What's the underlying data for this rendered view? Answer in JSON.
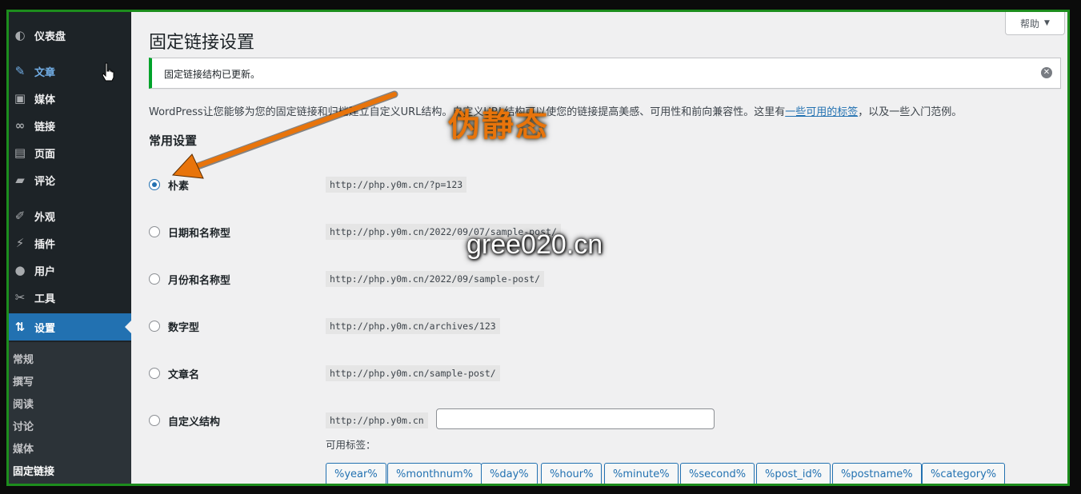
{
  "sidebar": {
    "items": [
      {
        "id": "dashboard",
        "label": "仪表盘",
        "icon": "dashboard-icon",
        "glyph": "◐"
      },
      {
        "id": "posts",
        "label": "文章",
        "icon": "pin-icon",
        "glyph": "✎"
      },
      {
        "id": "media",
        "label": "媒体",
        "icon": "media-icon",
        "glyph": "▣"
      },
      {
        "id": "links",
        "label": "链接",
        "icon": "link-icon",
        "glyph": "∞"
      },
      {
        "id": "pages",
        "label": "页面",
        "icon": "page-icon",
        "glyph": "▤"
      },
      {
        "id": "comments",
        "label": "评论",
        "icon": "comment-icon",
        "glyph": "▰"
      },
      {
        "id": "appearance",
        "label": "外观",
        "icon": "brush-icon",
        "glyph": "✐"
      },
      {
        "id": "plugins",
        "label": "插件",
        "icon": "plug-icon",
        "glyph": "⚡"
      },
      {
        "id": "users",
        "label": "用户",
        "icon": "user-icon",
        "glyph": "●"
      },
      {
        "id": "tools",
        "label": "工具",
        "icon": "wrench-icon",
        "glyph": "✂"
      },
      {
        "id": "settings",
        "label": "设置",
        "icon": "settings-icon",
        "glyph": "⇅"
      }
    ],
    "submenu": [
      "常规",
      "撰写",
      "阅读",
      "讨论",
      "媒体",
      "固定链接"
    ]
  },
  "header": {
    "help_label": "帮助",
    "help_arrow": "▼"
  },
  "page": {
    "title": "固定链接设置",
    "notice": "固定链接结构已更新。",
    "notice_close": "✕",
    "intro_before": "WordPress让您能够为您的固定链接和归档建立自定义URL结构。自定义URL结构可以使您的链接提高美感、可用性和前向兼容性。这里有",
    "intro_link": "一些可用的标签",
    "intro_after": "，以及一些入门范例。",
    "section_title": "常用设置",
    "options": [
      {
        "label": "朴素",
        "example": "http://php.y0m.cn/?p=123",
        "checked": true
      },
      {
        "label": "日期和名称型",
        "example": "http://php.y0m.cn/2022/09/07/sample-post/",
        "checked": false
      },
      {
        "label": "月份和名称型",
        "example": "http://php.y0m.cn/2022/09/sample-post/",
        "checked": false
      },
      {
        "label": "数字型",
        "example": "http://php.y0m.cn/archives/123",
        "checked": false
      },
      {
        "label": "文章名",
        "example": "http://php.y0m.cn/sample-post/",
        "checked": false
      },
      {
        "label": "自定义结构",
        "example": "http://php.y0m.cn",
        "checked": false
      }
    ],
    "custom_value": "",
    "available_tags_label": "可用标签：",
    "tags": [
      "%year%",
      "%monthnum%",
      "%day%",
      "%hour%",
      "%minute%",
      "%second%",
      "%post_id%",
      "%postname%",
      "%category%"
    ]
  },
  "overlay": {
    "watermark_cn": "伪静态",
    "watermark_url": "gree020.cn",
    "arrow_color": "#e8740b"
  }
}
